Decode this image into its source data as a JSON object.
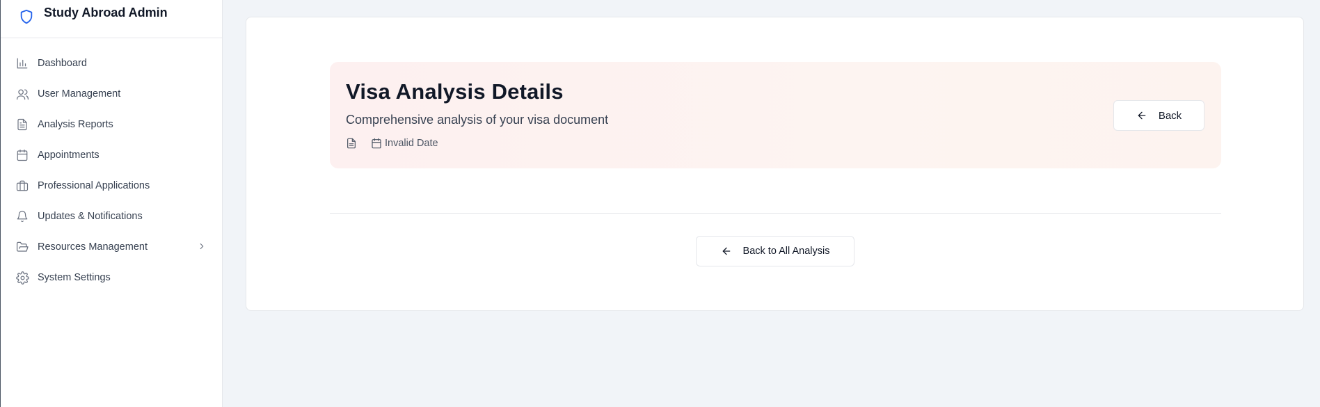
{
  "app": {
    "title": "Study Abroad Admin",
    "logo_icon": "shield-icon",
    "accent_color": "#2563eb"
  },
  "sidebar": {
    "items": [
      {
        "label": "Dashboard",
        "icon": "bar-chart-icon"
      },
      {
        "label": "User Management",
        "icon": "users-icon"
      },
      {
        "label": "Analysis Reports",
        "icon": "file-text-icon"
      },
      {
        "label": "Appointments",
        "icon": "calendar-icon"
      },
      {
        "label": "Professional Applications",
        "icon": "briefcase-icon"
      },
      {
        "label": "Updates & Notifications",
        "icon": "bell-icon"
      },
      {
        "label": "Resources Management",
        "icon": "folder-open-icon",
        "has_submenu": true
      },
      {
        "label": "System Settings",
        "icon": "gear-icon"
      }
    ]
  },
  "hero": {
    "title": "Visa Analysis Details",
    "subtitle": "Comprehensive analysis of your visa document",
    "date_text": "Invalid Date",
    "back_label": "Back"
  },
  "footer_actions": {
    "back_all_label": "Back to All Analysis"
  }
}
